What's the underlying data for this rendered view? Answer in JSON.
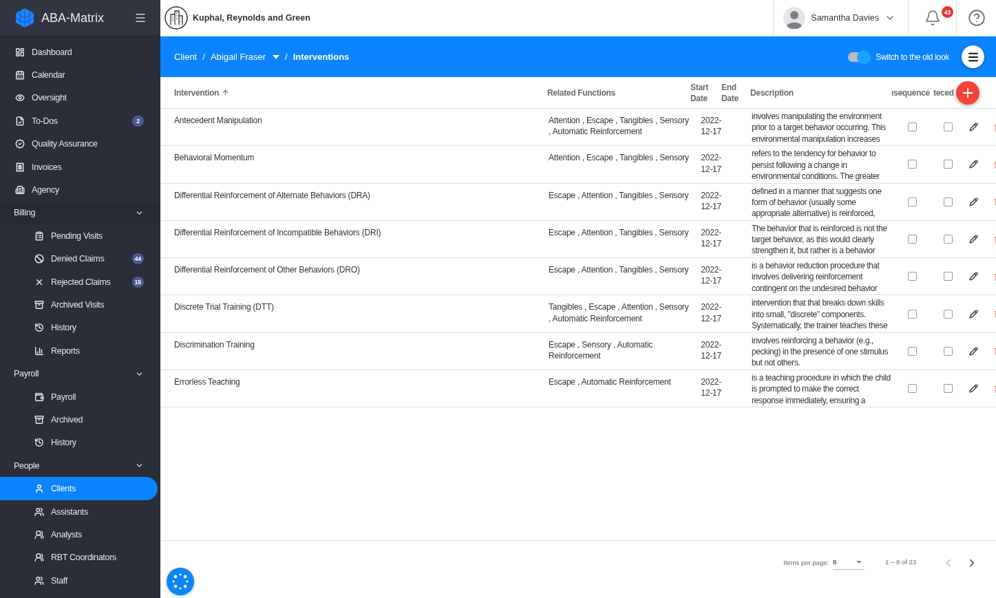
{
  "app": {
    "name": "ABA-Matrix"
  },
  "sidebar": {
    "items": [
      {
        "label": "Dashboard",
        "selected": false
      },
      {
        "label": "Calendar",
        "selected": false
      },
      {
        "label": "Oversight",
        "selected": false
      },
      {
        "label": "To-Dos",
        "badge": "2",
        "selected": false
      },
      {
        "label": "Quality Assurance",
        "selected": false
      },
      {
        "label": "Invoices",
        "selected": false
      },
      {
        "label": "Agency",
        "selected": false
      }
    ],
    "sections": [
      {
        "label": "Billing",
        "expanded": true,
        "children": [
          {
            "label": "Pending Visits",
            "selected": false
          },
          {
            "label": "Denied Claims",
            "badge": "44",
            "selected": false
          },
          {
            "label": "Rejected Claims",
            "badge": "15",
            "selected": false
          },
          {
            "label": "Archived Visits",
            "selected": false
          },
          {
            "label": "History",
            "selected": false
          },
          {
            "label": "Reports",
            "selected": false
          }
        ]
      },
      {
        "label": "Payroll",
        "expanded": true,
        "children": [
          {
            "label": "Payroll",
            "selected": false
          },
          {
            "label": "Archived",
            "selected": false
          },
          {
            "label": "History",
            "selected": false
          }
        ]
      },
      {
        "label": "People",
        "expanded": true,
        "children": [
          {
            "label": "Clients",
            "selected": true
          },
          {
            "label": "Assistants",
            "selected": false
          },
          {
            "label": "Analysts",
            "selected": false
          },
          {
            "label": "RBT Coordinators",
            "selected": false
          },
          {
            "label": "Staff",
            "selected": false
          }
        ]
      }
    ]
  },
  "header": {
    "company": "Kuphal, Reynolds and Green",
    "user": "Samantha Davies",
    "notifications": "43"
  },
  "breadcrumb": [
    {
      "kind": "link",
      "text": "Client"
    },
    {
      "kind": "separator",
      "text": "/"
    },
    {
      "kind": "dropdown",
      "text": "Abigail Fraser"
    },
    {
      "kind": "separator",
      "text": "/"
    },
    {
      "kind": "current",
      "text": "Interventions"
    }
  ],
  "toggle": {
    "label": "Switch to the old look",
    "on": true
  },
  "table": {
    "columns": [
      {
        "label": "Intervention",
        "sorted": true
      },
      {
        "label": "Related Functions",
        "sorted": false
      },
      {
        "label": "Start Date",
        "sorted": false
      },
      {
        "label": "End Date",
        "sorted": false
      },
      {
        "label": "Description",
        "sorted": false
      },
      {
        "label": "ısequence",
        "sorted": false
      },
      {
        "label": "teced",
        "sorted": false
      }
    ],
    "rows": [
      {
        "intervention": "Antecedent Manipulation",
        "functions": "Attention , Escape , Tangibles , Sensory , Automatic Reinforcement",
        "start_date": "2022-12-17",
        "description": "involves manipulating the environment prior to a target behavior occurring. This environmental manipulation increases",
        "check_1": false,
        "check_2": false
      },
      {
        "intervention": "Behavioral Momentum",
        "functions": "Attention , Escape , Tangibles , Sensory",
        "start_date": "2022-12-17",
        "description": "refers to the tendency for behavior to persist following a change in environmental conditions. The greater",
        "check_1": false,
        "check_2": false
      },
      {
        "intervention": "Differential Reinforcement of Alternate Behaviors (DRA)",
        "functions": "Escape , Attention , Tangibles , Sensory",
        "start_date": "2022-12-17",
        "description": "defined in a manner that suggests one form of behavior (usually some appropriate alternative) is reinforced,",
        "check_1": false,
        "check_2": false
      },
      {
        "intervention": "Differential Reinforcement of Incompatible Behaviors (DRI)",
        "functions": "Escape , Attention , Tangibles , Sensory",
        "start_date": "2022-12-17",
        "description": "The behavior that is reinforced is not the target behavior, as this would clearly strengthen it, but rather is a behavior",
        "check_1": false,
        "check_2": false
      },
      {
        "intervention": "Differential Reinforcement of Other Behaviors (DRO)",
        "functions": "Escape , Attention , Tangibles , Sensory",
        "start_date": "2022-12-17",
        "description": "is a behavior reduction procedure that involves delivering reinforcement contingent on the undesired behavior",
        "check_1": false,
        "check_2": false
      },
      {
        "intervention": "Discrete Trial Training (DTT)",
        "functions": "Tangibles , Escape , Attention , Sensory , Automatic Reinforcement",
        "start_date": "2022-12-17",
        "description": "intervention that that breaks down skills into small, \"discrete\" components. Systematically, the trainer teaches these",
        "check_1": false,
        "check_2": false
      },
      {
        "intervention": "Discrimination Training",
        "functions": "Escape , Sensory , Automatic Reinforcement",
        "start_date": "2022-12-17",
        "description": "involves reinforcing a behavior (e.g., pecking) in the presence of one stimulus but not others.",
        "check_1": false,
        "check_2": false
      },
      {
        "intervention": "Errorless Teaching",
        "functions": "Escape , Automatic Reinforcement",
        "start_date": "2022-12-17",
        "description": "is a teaching procedure in which the child is prompted to make the correct response immediately, ensuring a",
        "check_1": false,
        "check_2": false
      }
    ]
  },
  "pagination": {
    "items_per_page_label": "Items per page:",
    "items_per_page": "8",
    "range": "1 – 8 of 23",
    "prev_disabled": true,
    "next_disabled": false
  }
}
